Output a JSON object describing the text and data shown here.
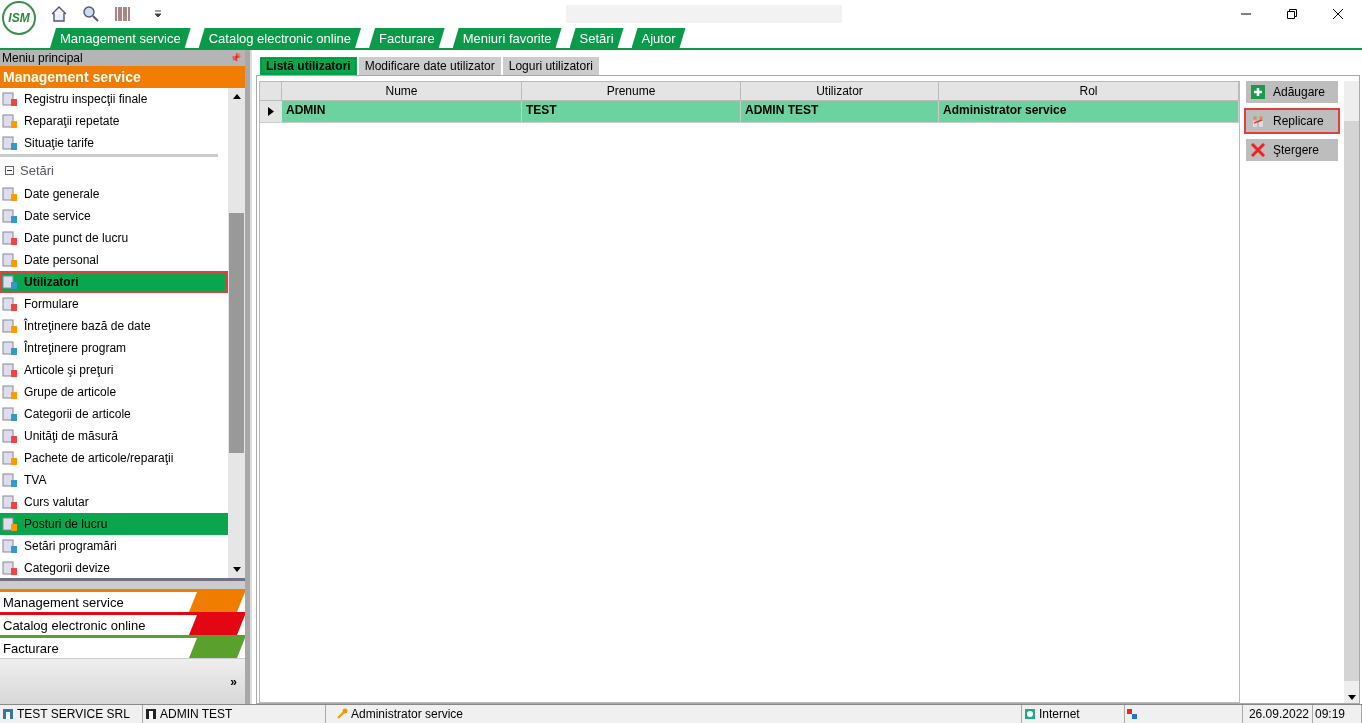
{
  "app": {
    "logo_text": "ISM"
  },
  "menu_tabs": [
    "Management service",
    "Catalog electronic online",
    "Facturare",
    "Meniuri favorite",
    "Setări",
    "Ajutor"
  ],
  "sidebar": {
    "title": "Meniu principal",
    "pin": "📌",
    "section": "Management service",
    "items": [
      {
        "kind": "item",
        "label": "Registru inspecţii finale",
        "selected": false,
        "highlighted": false,
        "outlined": false
      },
      {
        "kind": "item",
        "label": "Reparaţii repetate",
        "selected": false,
        "highlighted": false,
        "outlined": false
      },
      {
        "kind": "item",
        "label": "Situaţie tarife",
        "selected": false,
        "highlighted": false,
        "outlined": false
      },
      {
        "kind": "group",
        "label": "Setări",
        "expanded": true
      },
      {
        "kind": "item",
        "label": "Date generale",
        "selected": false,
        "highlighted": false,
        "outlined": false
      },
      {
        "kind": "item",
        "label": "Date service",
        "selected": false,
        "highlighted": false,
        "outlined": false
      },
      {
        "kind": "item",
        "label": "Date punct de lucru",
        "selected": false,
        "highlighted": false,
        "outlined": false
      },
      {
        "kind": "item",
        "label": "Date personal",
        "selected": false,
        "highlighted": false,
        "outlined": false
      },
      {
        "kind": "item",
        "label": "Utilizatori",
        "selected": true,
        "highlighted": true,
        "outlined": true
      },
      {
        "kind": "item",
        "label": "Formulare",
        "selected": false,
        "highlighted": false,
        "outlined": false
      },
      {
        "kind": "item",
        "label": "Întreţinere bază de date",
        "selected": false,
        "highlighted": false,
        "outlined": false
      },
      {
        "kind": "item",
        "label": "Întreţinere program",
        "selected": false,
        "highlighted": false,
        "outlined": false
      },
      {
        "kind": "item",
        "label": "Articole şi preţuri",
        "selected": false,
        "highlighted": false,
        "outlined": false
      },
      {
        "kind": "item",
        "label": "Grupe de articole",
        "selected": false,
        "highlighted": false,
        "outlined": false
      },
      {
        "kind": "item",
        "label": "Categorii de articole",
        "selected": false,
        "highlighted": false,
        "outlined": false
      },
      {
        "kind": "item",
        "label": "Unităţi de măsură",
        "selected": false,
        "highlighted": false,
        "outlined": false
      },
      {
        "kind": "item",
        "label": "Pachete de articole/reparaţii",
        "selected": false,
        "highlighted": false,
        "outlined": false
      },
      {
        "kind": "item",
        "label": "TVA",
        "selected": false,
        "highlighted": false,
        "outlined": false
      },
      {
        "kind": "item",
        "label": "Curs valutar",
        "selected": false,
        "highlighted": false,
        "outlined": false
      },
      {
        "kind": "item",
        "label": "Posturi de lucru",
        "selected": false,
        "highlighted": true,
        "outlined": false
      },
      {
        "kind": "item",
        "label": "Setări programări",
        "selected": false,
        "highlighted": false,
        "outlined": false
      },
      {
        "kind": "item",
        "label": "Categorii devize",
        "selected": false,
        "highlighted": false,
        "outlined": false
      }
    ],
    "modules": [
      {
        "label": "Management service",
        "color": "#f07d00"
      },
      {
        "label": "Catalog electronic online",
        "color": "#e30613"
      },
      {
        "label": "Facturare",
        "color": "#5aa02c"
      }
    ],
    "more": "»"
  },
  "content_tabs": [
    {
      "label": "Listă utilizatori",
      "selected": true
    },
    {
      "label": "Modificare date utilizator",
      "selected": false
    },
    {
      "label": "Loguri utilizatori",
      "selected": false
    }
  ],
  "table": {
    "columns": [
      "Nume",
      "Prenume",
      "Utilizator",
      "Rol"
    ],
    "rows": [
      {
        "cells": [
          "ADMIN",
          "TEST",
          "ADMIN TEST",
          "Administrator service"
        ],
        "selected": true
      }
    ]
  },
  "actions": [
    {
      "kind": "add",
      "label": "Adăugare",
      "outlined": false
    },
    {
      "kind": "replicate",
      "label": "Replicare",
      "outlined": true
    },
    {
      "kind": "delete",
      "label": "Ştergere",
      "outlined": false
    }
  ],
  "status_bar": {
    "company": "TEST SERVICE SRL",
    "user": "ADMIN TEST",
    "role": "Administrator service",
    "zone": "Internet",
    "date": "26.09.2022",
    "time": "09:19"
  }
}
